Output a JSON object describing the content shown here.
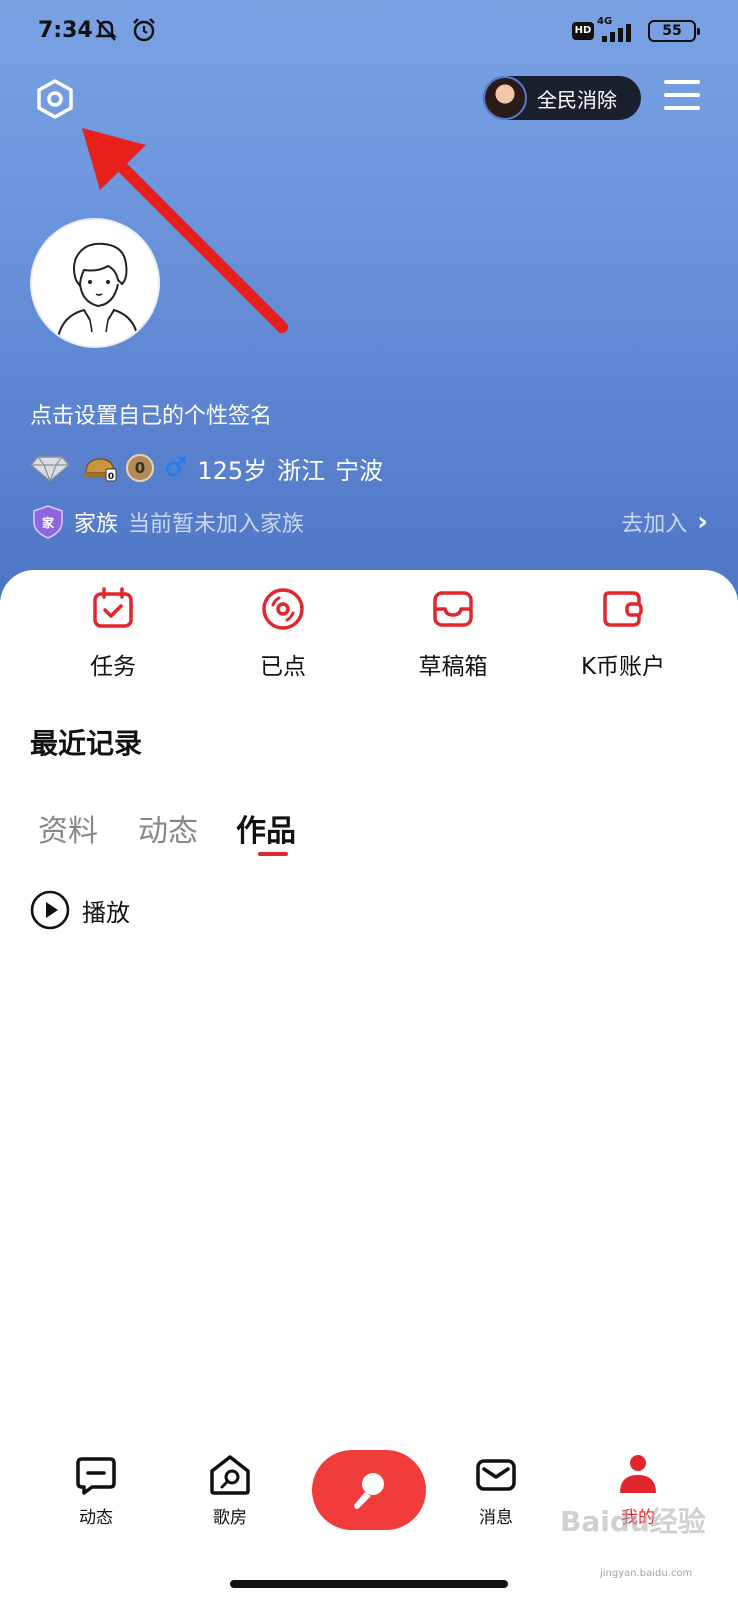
{
  "status_bar": {
    "time": "7:34",
    "network_badge": "HD",
    "network_type": "4G",
    "battery": "55"
  },
  "header": {
    "promo_label": "全民消除"
  },
  "profile": {
    "signature": "点击设置自己的个性签名",
    "coin_count": "0",
    "gender_symbol": "♂",
    "age": "125岁",
    "province": "浙江",
    "city": "宁波"
  },
  "family": {
    "label": "家族",
    "status": "当前暂未加入家族",
    "join": "去加入"
  },
  "quick_actions": [
    {
      "label": "任务"
    },
    {
      "label": "已点"
    },
    {
      "label": "草稿箱"
    },
    {
      "label": "K币账户"
    }
  ],
  "recent": {
    "title": "最近记录"
  },
  "tabs": [
    {
      "label": "资料"
    },
    {
      "label": "动态"
    },
    {
      "label": "作品"
    }
  ],
  "play": {
    "label": "播放"
  },
  "bottom_nav": [
    {
      "label": "动态"
    },
    {
      "label": "歌房"
    },
    {
      "label": "消息"
    },
    {
      "label": "我的"
    }
  ],
  "watermark": {
    "text": "Baidu经验",
    "sub": "jingyan.baidu.com"
  },
  "colors": {
    "accent_red": "#e1262e",
    "hero_blue": "#6c95dc",
    "gender_blue": "#1e7cf2"
  }
}
